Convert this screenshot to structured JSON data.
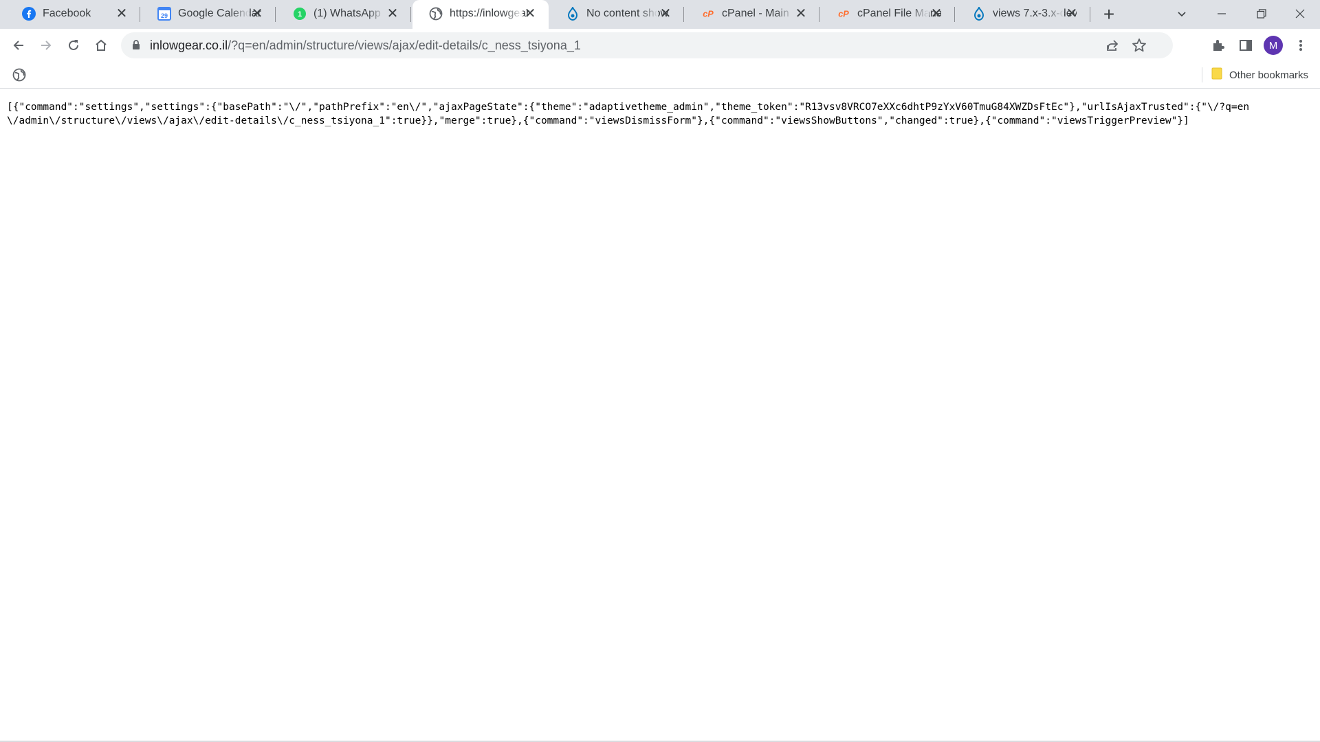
{
  "browser": {
    "tabs": [
      {
        "title": "Facebook",
        "icon": "facebook-icon",
        "active": false
      },
      {
        "title": "Google Calendar",
        "icon": "google-calendar-icon",
        "icon_text": "29",
        "active": false
      },
      {
        "title": "(1) WhatsApp",
        "icon": "whatsapp-icon",
        "icon_text": "1",
        "active": false
      },
      {
        "title": "https://inlowgear",
        "icon": "globe-icon",
        "active": true
      },
      {
        "title": "No content show",
        "icon": "drupal-icon",
        "active": false
      },
      {
        "title": "cPanel - Main",
        "icon": "cpanel-icon",
        "icon_text": "cP",
        "active": false
      },
      {
        "title": "cPanel File Manag",
        "icon": "cpanel-icon",
        "icon_text": "cP",
        "active": false
      },
      {
        "title": "views 7.x-3.x-dev",
        "icon": "drupal-icon",
        "active": false
      }
    ],
    "address_bar": {
      "domain": "inlowgear.co.il",
      "path": "/?q=en/admin/structure/views/ajax/edit-details/c_ness_tsiyona_1"
    },
    "profile_initial": "M",
    "bookmarks": {
      "other_label": "Other bookmarks"
    }
  },
  "page": {
    "text": "[{\"command\":\"settings\",\"settings\":{\"basePath\":\"\\/\",\"pathPrefix\":\"en\\/\",\"ajaxPageState\":{\"theme\":\"adaptivetheme_admin\",\"theme_token\":\"R13vsv8VRCO7eXXc6dhtP9zYxV60TmuG84XWZDsFtEc\"},\"urlIsAjaxTrusted\":{\"\\/?q=en\\/admin\\/structure\\/views\\/ajax\\/edit-details\\/c_ness_tsiyona_1\":true}},\"merge\":true},{\"command\":\"viewsDismissForm\"},{\"command\":\"viewsShowButtons\",\"changed\":true},{\"command\":\"viewsTriggerPreview\"}]"
  },
  "colors": {
    "tabstrip_bg": "#dee1e6",
    "facebook_blue": "#1877f2",
    "whatsapp_green": "#25d366",
    "drupal_blue": "#0678be",
    "cpanel_orange": "#ff6c2c",
    "profile_purple": "#5e35b1",
    "folder_yellow": "#f9d949"
  }
}
